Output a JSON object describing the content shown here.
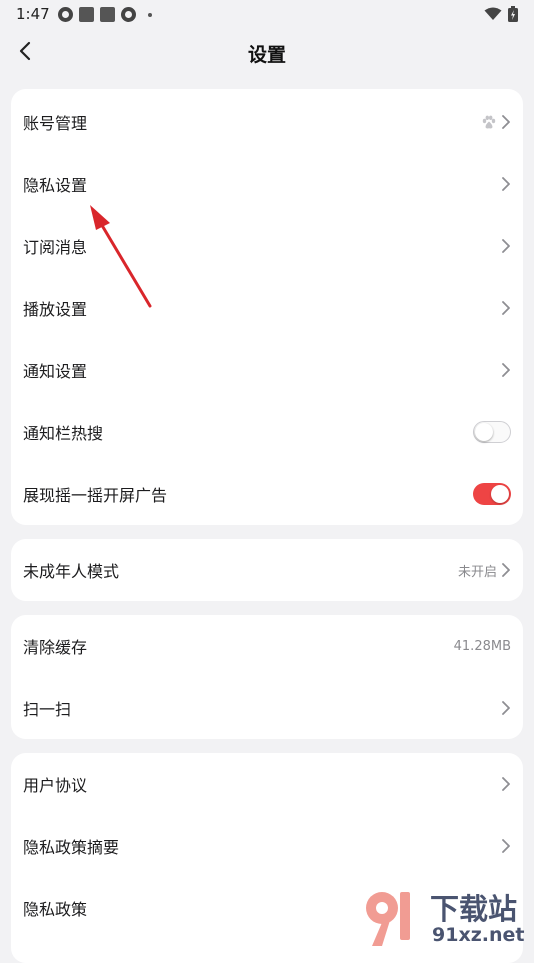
{
  "status_bar": {
    "time": "1:47"
  },
  "header": {
    "title": "设置"
  },
  "card1": {
    "rows": [
      {
        "label": "账号管理"
      },
      {
        "label": "隐私设置"
      },
      {
        "label": "订阅消息"
      },
      {
        "label": "播放设置"
      },
      {
        "label": "通知设置"
      },
      {
        "label": "通知栏热搜",
        "toggle": false
      },
      {
        "label": "展现摇一摇开屏广告",
        "toggle": true
      }
    ]
  },
  "card2": {
    "rows": [
      {
        "label": "未成年人模式",
        "value": "未开启"
      }
    ]
  },
  "card3": {
    "rows": [
      {
        "label": "清除缓存",
        "value": "41.28MB"
      },
      {
        "label": "扫一扫"
      }
    ]
  },
  "card4": {
    "rows": [
      {
        "label": "用户协议"
      },
      {
        "label": "隐私政策摘要"
      },
      {
        "label": "隐私政策"
      }
    ]
  },
  "watermark": {
    "brand": "下载站",
    "url": "91xz.net"
  },
  "colors": {
    "accent_red": "#ee4444",
    "annotation_arrow": "#d9262b",
    "background": "#f2f2f4"
  }
}
